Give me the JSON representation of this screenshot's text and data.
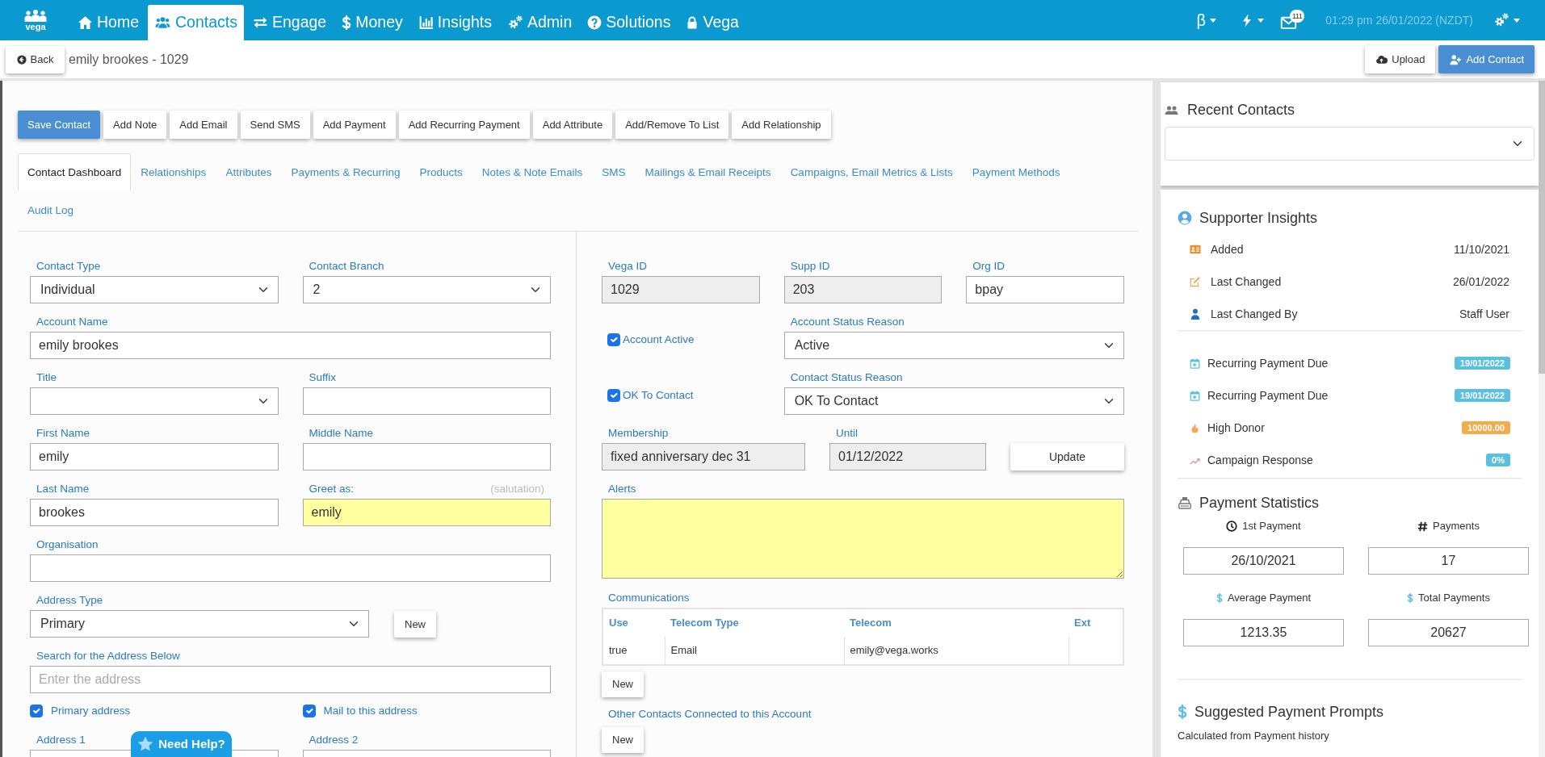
{
  "navbar": {
    "logo": "vega",
    "items": [
      {
        "label": "Home",
        "selected": false
      },
      {
        "label": "Contacts",
        "selected": true
      },
      {
        "label": "Engage",
        "selected": false
      },
      {
        "label": "Money",
        "selected": false
      },
      {
        "label": "Insights",
        "selected": false
      },
      {
        "label": "Admin",
        "selected": false
      },
      {
        "label": "Solutions",
        "selected": false
      },
      {
        "label": "Vega",
        "selected": false
      }
    ],
    "beta_menu": "β",
    "notification_count": "111",
    "datetime": "01:29 pm 26/01/2022 (NZDT)"
  },
  "page_header": {
    "back_button": "Back",
    "title": "emily brookes - 1029",
    "buttons": [
      {
        "label": "Upload",
        "kind": "default"
      },
      {
        "label": "Add Contact",
        "kind": "primary"
      }
    ]
  },
  "toolbar": [
    {
      "label": "Save Contact",
      "kind": "primary"
    },
    {
      "label": "Add Note",
      "kind": "default"
    },
    {
      "label": "Add Email",
      "kind": "default"
    },
    {
      "label": "Send SMS",
      "kind": "default"
    },
    {
      "label": "Add Payment",
      "kind": "default"
    },
    {
      "label": "Add Recurring Payment",
      "kind": "default"
    },
    {
      "label": "Add Attribute",
      "kind": "default"
    },
    {
      "label": "Add/Remove To List",
      "kind": "default"
    },
    {
      "label": "Add Relationship",
      "kind": "default"
    }
  ],
  "tabs": [
    {
      "label": "Contact Dashboard",
      "selected": true
    },
    {
      "label": "Relationships",
      "selected": false
    },
    {
      "label": "Attributes",
      "selected": false
    },
    {
      "label": "Payments & Recurring",
      "selected": false
    },
    {
      "label": "Products",
      "selected": false
    },
    {
      "label": "Notes & Note Emails",
      "selected": false
    },
    {
      "label": "SMS",
      "selected": false
    },
    {
      "label": "Mailings & Email Receipts",
      "selected": false
    },
    {
      "label": "Campaigns, Email Metrics & Lists",
      "selected": false
    },
    {
      "label": "Payment Methods",
      "selected": false
    },
    {
      "label": "Audit Log",
      "selected": false
    }
  ],
  "contact_form": {
    "rows": [
      [
        {
          "label": "Contact Type",
          "kind": "select",
          "value": "Individual",
          "highlighted": false
        },
        {
          "label": "Contact Branch",
          "kind": "select",
          "value": "2",
          "highlighted": false
        }
      ],
      [
        {
          "label": "Account Name",
          "kind": "text",
          "value": "emily brookes",
          "highlighted": false
        }
      ],
      [
        {
          "label": "Title",
          "kind": "select",
          "highlighted": false
        },
        {
          "label": "Suffix",
          "kind": "text",
          "highlighted": false
        }
      ],
      [
        {
          "label": "First Name",
          "kind": "text",
          "value": "emily",
          "highlighted": false
        },
        {
          "label": "Middle Name",
          "kind": "text",
          "highlighted": false
        }
      ],
      [
        {
          "label": "Last Name",
          "kind": "text",
          "value": "brookes",
          "highlighted": false
        },
        {
          "label": "Greet as:",
          "hint": "(salutation)",
          "kind": "text",
          "value": "emily",
          "highlighted": true
        }
      ],
      [
        {
          "label": "Organisation",
          "kind": "text",
          "highlighted": false
        }
      ]
    ]
  },
  "address": {
    "type": {
      "label": "Address Type",
      "value": "Primary"
    },
    "new_button": "New",
    "search": {
      "label": "Search for the Address Below",
      "placeholder": "Enter the address"
    },
    "options": [
      {
        "label": "Primary address",
        "checked": true
      },
      {
        "label": "Mail to this address",
        "checked": true
      }
    ],
    "fields": [
      {
        "label": "Address 1"
      },
      {
        "label": "Address 2"
      }
    ]
  },
  "details": {
    "ids": [
      {
        "label": "Vega ID",
        "value": "1029",
        "readonly": true
      },
      {
        "label": "Supp ID",
        "value": "203",
        "readonly": true
      },
      {
        "label": "Org ID",
        "value": "bpay",
        "readonly": false
      }
    ],
    "statuses": [
      {
        "checkbox_label": "Account Active",
        "checked": true,
        "select_label": "Account Status Reason",
        "value": "Active"
      },
      {
        "checkbox_label": "OK To Contact",
        "checked": true,
        "select_label": "Contact Status Reason",
        "value": "OK To Contact"
      }
    ],
    "membership": {
      "fields": [
        {
          "label": "Membership",
          "value": "fixed anniversary dec 31",
          "readonly": true
        },
        {
          "label": "Until",
          "value": "01/12/2022",
          "readonly": true
        }
      ],
      "button": "Update"
    },
    "alerts": {
      "label": "Alerts",
      "highlighted": true
    },
    "communications": {
      "label": "Communications",
      "columns": [
        "Use",
        "Telecom Type",
        "Telecom",
        "Ext"
      ],
      "rows": [
        [
          "true",
          "Email",
          "emily@vega.works"
        ]
      ],
      "button": "New"
    },
    "other_contacts": {
      "label": "Other Contacts Connected to this Account",
      "button": "New"
    }
  },
  "help_button": "Need Help?",
  "sidebar": {
    "recent_contacts": {
      "title": "Recent Contacts"
    },
    "supporter_insights": {
      "title": "Supporter Insights",
      "facts": [
        {
          "label": "Added",
          "value": "11/10/2021"
        },
        {
          "label": "Last Changed",
          "value": "26/01/2022"
        },
        {
          "label": "Last Changed By",
          "value": "Staff User"
        }
      ],
      "flags": [
        {
          "label": "Recurring Payment Due",
          "badge": "19/01/2022",
          "color": "#5bc0de"
        },
        {
          "label": "Recurring Payment Due",
          "badge": "19/01/2022",
          "color": "#5bc0de"
        },
        {
          "label": "High Donor",
          "badge": "10000.00",
          "color": "#f0ad4e"
        },
        {
          "label": "Campaign Response",
          "badge": "0%",
          "color": "#5bc0de"
        }
      ]
    },
    "payment_statistics": {
      "title": "Payment Statistics",
      "stats": [
        {
          "label": "1st Payment",
          "value": "26/10/2021"
        },
        {
          "label": "Payments",
          "value": "17"
        },
        {
          "label": "Average Payment",
          "value": "1213.35"
        },
        {
          "label": "Total Payments",
          "value": "20627"
        }
      ]
    },
    "suggested_payment_prompts": {
      "title": "Suggested Payment Prompts",
      "subtitle": "Calculated from Payment history"
    }
  }
}
